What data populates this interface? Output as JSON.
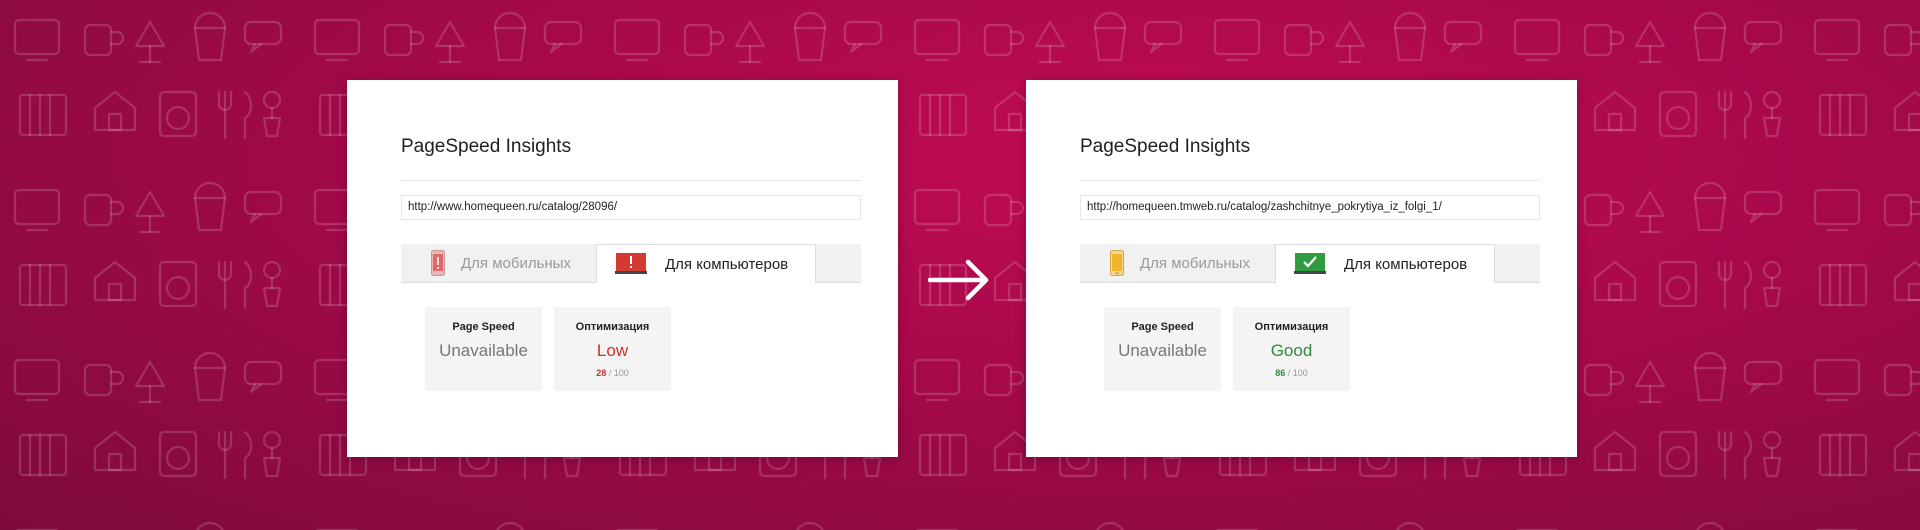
{
  "colors": {
    "bg": "#b00a50",
    "low": "#c9322c",
    "good": "#2e8b3a"
  },
  "before": {
    "title": "PageSpeed Insights",
    "url": "http://www.homequeen.ru/catalog/28096/",
    "tabs": {
      "mobile": {
        "label": "Для мобильных",
        "icon": "phone-warning-icon"
      },
      "desktop": {
        "label": "Для компьютеров",
        "icon": "monitor-warning-icon"
      }
    },
    "speed": {
      "label": "Page Speed",
      "value": "Unavailable"
    },
    "optimization": {
      "label": "Оптимизация",
      "status": "Low",
      "score": "28",
      "max": "/ 100"
    }
  },
  "after": {
    "title": "PageSpeed Insights",
    "url": "http://homequeen.tmweb.ru/catalog/zashchitnye_pokrytiya_iz_folgi_1/",
    "tabs": {
      "mobile": {
        "label": "Для мобильных",
        "icon": "phone-ok-icon"
      },
      "desktop": {
        "label": "Для компьютеров",
        "icon": "monitor-check-icon"
      }
    },
    "speed": {
      "label": "Page Speed",
      "value": "Unavailable"
    },
    "optimization": {
      "label": "Оптимизация",
      "status": "Good",
      "score": "86",
      "max": "/ 100"
    }
  },
  "arrow_icon": "arrow-right-icon"
}
